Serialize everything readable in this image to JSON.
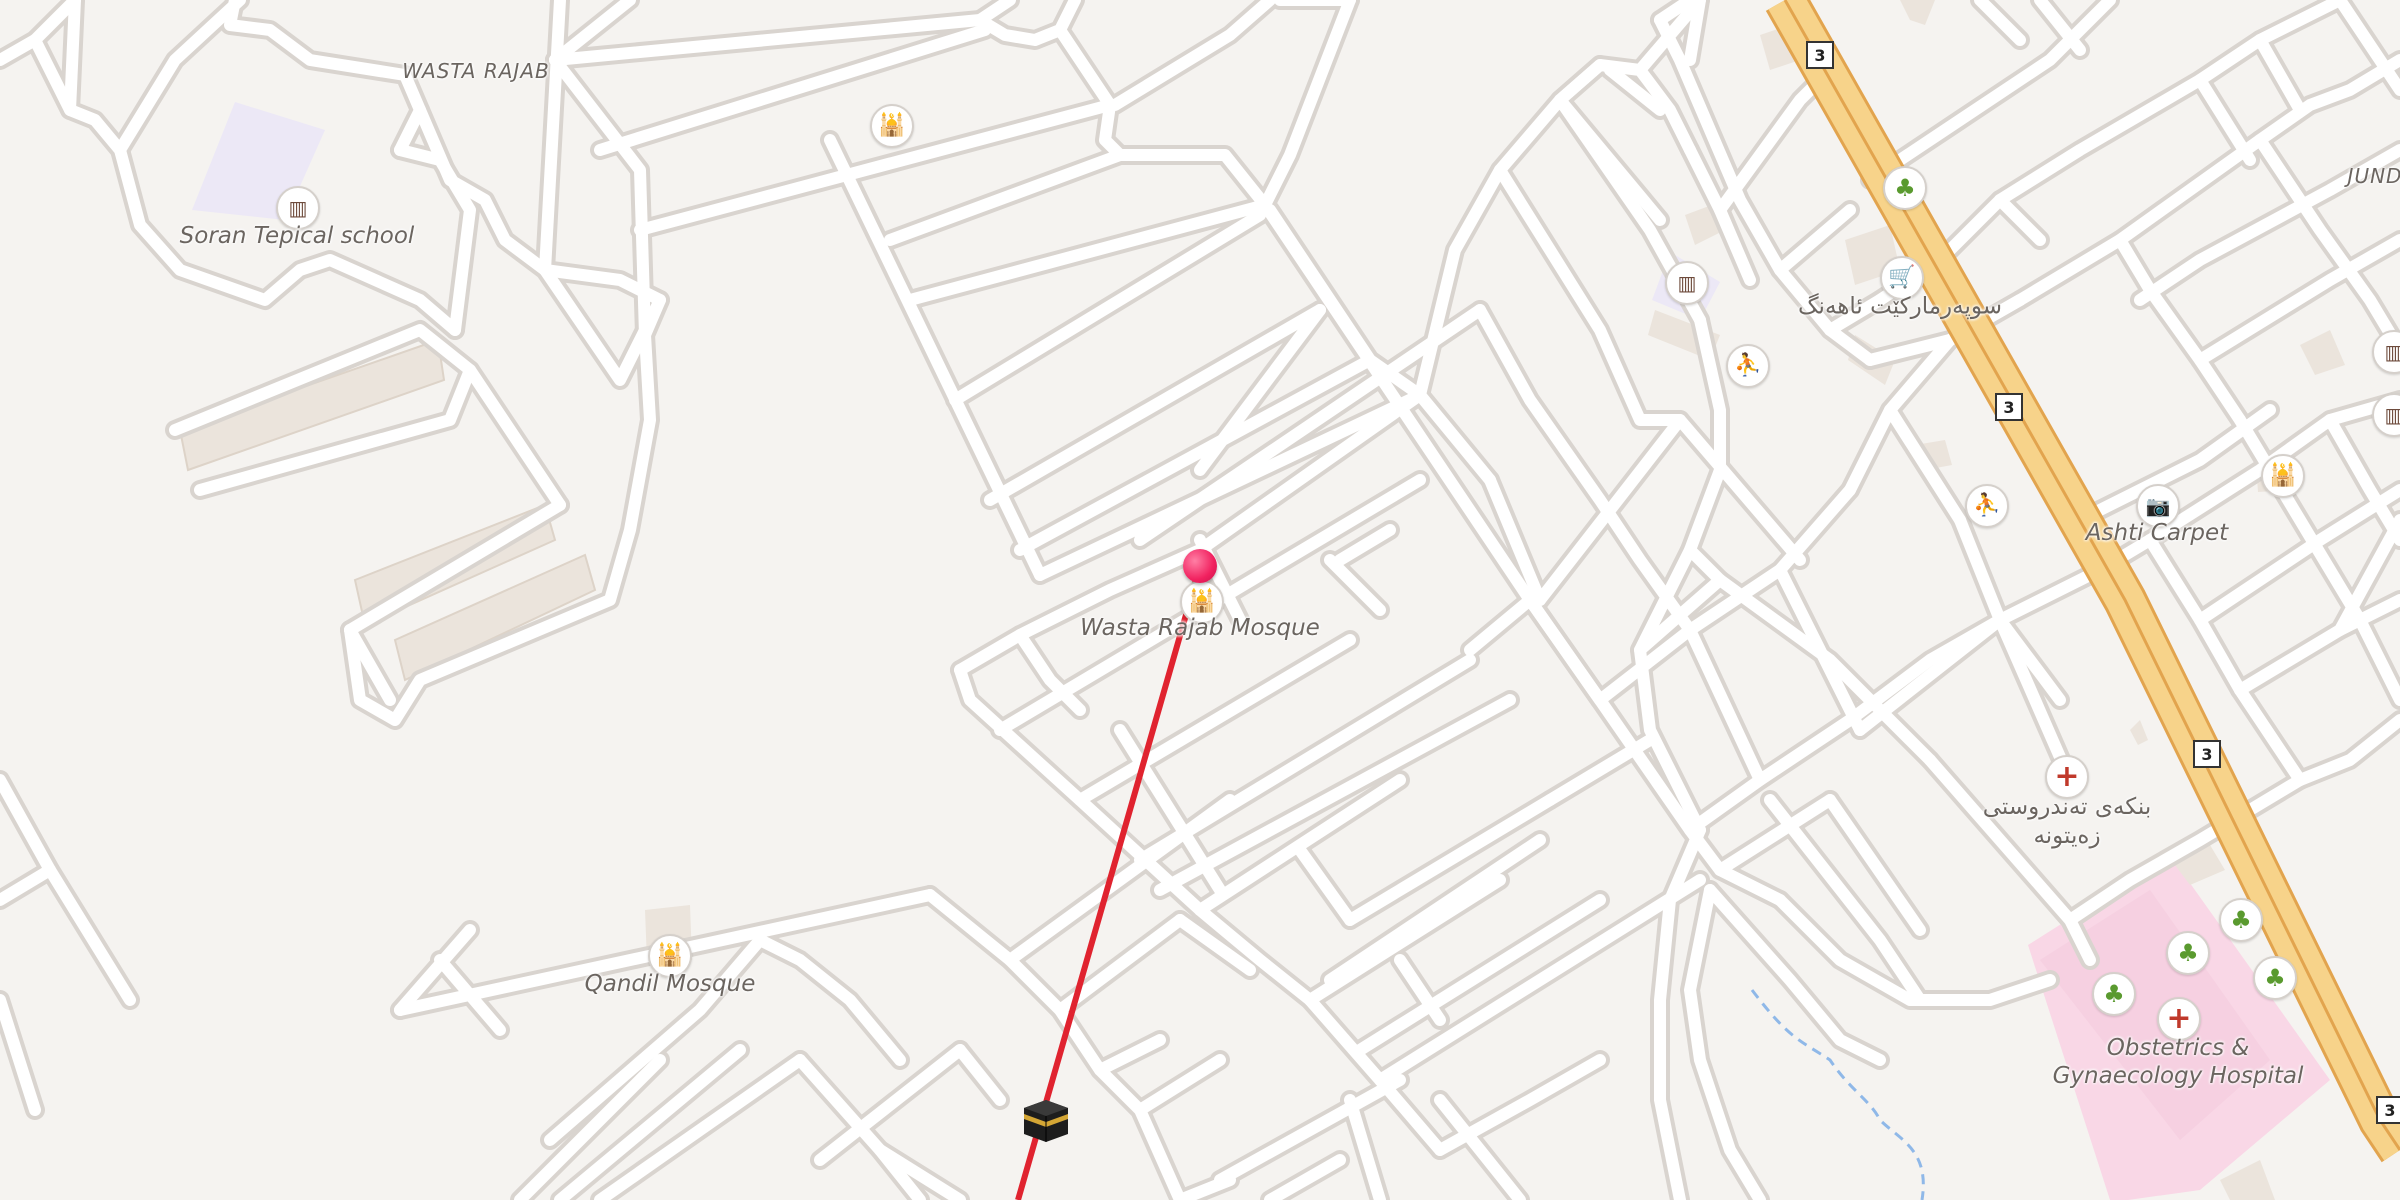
{
  "map": {
    "area_labels": {
      "wasta_rajab": "WASTA RAJAB",
      "jund": "JUND"
    },
    "places": {
      "soran_school": "Soran Tepical school",
      "wasta_rajab_mosque": "Wasta Rajab Mosque",
      "qandil_mosque": "Qandil Mosque",
      "ashti_carpet": "Ashti Carpet",
      "supermarket": "سوپەرمارکێت ئاهەنگ",
      "health_center_line1": "بنکەی تەندروستی",
      "health_center_line2": "زەیتونە",
      "hospital_line1": "Obstetrics &",
      "hospital_line2": "Gynaecology Hospital"
    },
    "road_shields": [
      "3",
      "3",
      "3",
      "3"
    ],
    "icons": {
      "mosque": "mosque-icon",
      "school": "school-icon",
      "park": "tree-icon",
      "shop": "shopping-cart-icon",
      "photo": "camera-icon",
      "hospital": "hospital-cross-icon",
      "sport": "sport-icon",
      "pin": "location-pin-icon",
      "kaaba": "kaaba-icon"
    },
    "colors": {
      "background": "#f5f3f0",
      "road": "#ffffff",
      "road_casing": "#d9d4cf",
      "highway": "#f7d38a",
      "highway_casing": "#e2a44e",
      "school_area": "#ece8f6",
      "hospital_area": "#f9d7e6",
      "building": "#ebe4dc",
      "qibla_line": "#e0232f",
      "pin": "#f1215f",
      "water": "#8fb8e8"
    }
  }
}
